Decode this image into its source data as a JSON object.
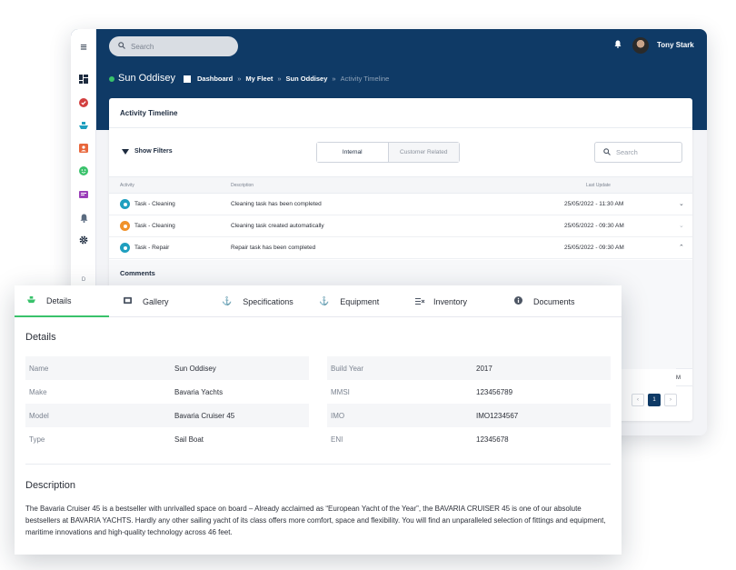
{
  "header": {
    "search_placeholder": "Search",
    "user_name": "Tony Stark"
  },
  "vessel": {
    "name": "Sun Oddisey",
    "status_color": "#39c26b"
  },
  "breadcrumb": {
    "items": [
      "Dashboard",
      "My Fleet",
      "Sun Oddisey"
    ],
    "current": "Activity Timeline",
    "separator": "»"
  },
  "sidebar": {
    "icons": [
      "menu-icon",
      "dashboard-icon",
      "check-circle-icon",
      "ship-icon",
      "contact-icon",
      "smile-icon",
      "gallery-icon",
      "bell-icon",
      "gear-icon"
    ],
    "bottom_letter": "D",
    "colors": [
      "#1d2b3f",
      "#d23f3f",
      "#1f9fbf",
      "#e8673c",
      "#39c26b",
      "#9b3fb8",
      "#5a6b80",
      "#1d2b3f"
    ]
  },
  "card": {
    "title": "Activity Timeline",
    "show_filters": "Show Filters",
    "segments": [
      "Internal",
      "Customer Related"
    ],
    "search_placeholder": "Search",
    "columns": {
      "activity": "Activity",
      "description": "Description",
      "last_update": "Last Update"
    },
    "rows": [
      {
        "activity": "Task - Cleaning",
        "description": "Cleaning task has been completed",
        "date": "25/05/2022 - 11:30 AM",
        "status_color": "#1f9fbf",
        "chevron": "⌄"
      },
      {
        "activity": "Task - Cleaning",
        "description": "Cleaning task created automatically",
        "date": "25/05/2022 - 09:30 AM",
        "status_color": "#f0922b",
        "chevron": "⌄"
      },
      {
        "activity": "Task - Repair",
        "description": "Repair task has been completed",
        "date": "25/05/2022 - 09:30 AM",
        "status_color": "#1f9fbf",
        "chevron": "⌃"
      }
    ],
    "comments_label": "Comments",
    "partial_row_text": "M",
    "pager": {
      "prev": "‹",
      "page": "1",
      "next": "›"
    }
  },
  "detail": {
    "tabs": [
      {
        "label": "Details",
        "icon": "ship-icon"
      },
      {
        "label": "Gallery",
        "icon": "image-icon"
      },
      {
        "label": "Specifications",
        "icon": "anchor-icon"
      },
      {
        "label": "Equipment",
        "icon": "anchor-icon"
      },
      {
        "label": "Inventory",
        "icon": "list-check-icon"
      },
      {
        "label": "Documents",
        "icon": "info-icon"
      }
    ],
    "section_title": "Details",
    "left": [
      {
        "key": "Name",
        "value": "Sun Oddisey"
      },
      {
        "key": "Make",
        "value": "Bavaria Yachts"
      },
      {
        "key": "Model",
        "value": "Bavaria Cruiser 45"
      },
      {
        "key": "Type",
        "value": "Sail Boat"
      }
    ],
    "right": [
      {
        "key": "Build Year",
        "value": "2017"
      },
      {
        "key": "MMSI",
        "value": "123456789"
      },
      {
        "key": "IMO",
        "value": "IMO1234567"
      },
      {
        "key": "ENI",
        "value": "12345678"
      }
    ],
    "description_title": "Description",
    "description_text": "The Bavaria Cruiser 45 is a bestseller with unrivalled space on board – Already acclaimed as “European Yacht of the Year”, the BAVARIA CRUISER 45 is one of our absolute bestsellers at BAVARIA YACHTS. Hardly any other sailing yacht of its class offers more comfort, space and flexibility. You will find an unparalleled selection of fittings and equipment, maritime innovations and high-quality technology across 46 feet."
  }
}
